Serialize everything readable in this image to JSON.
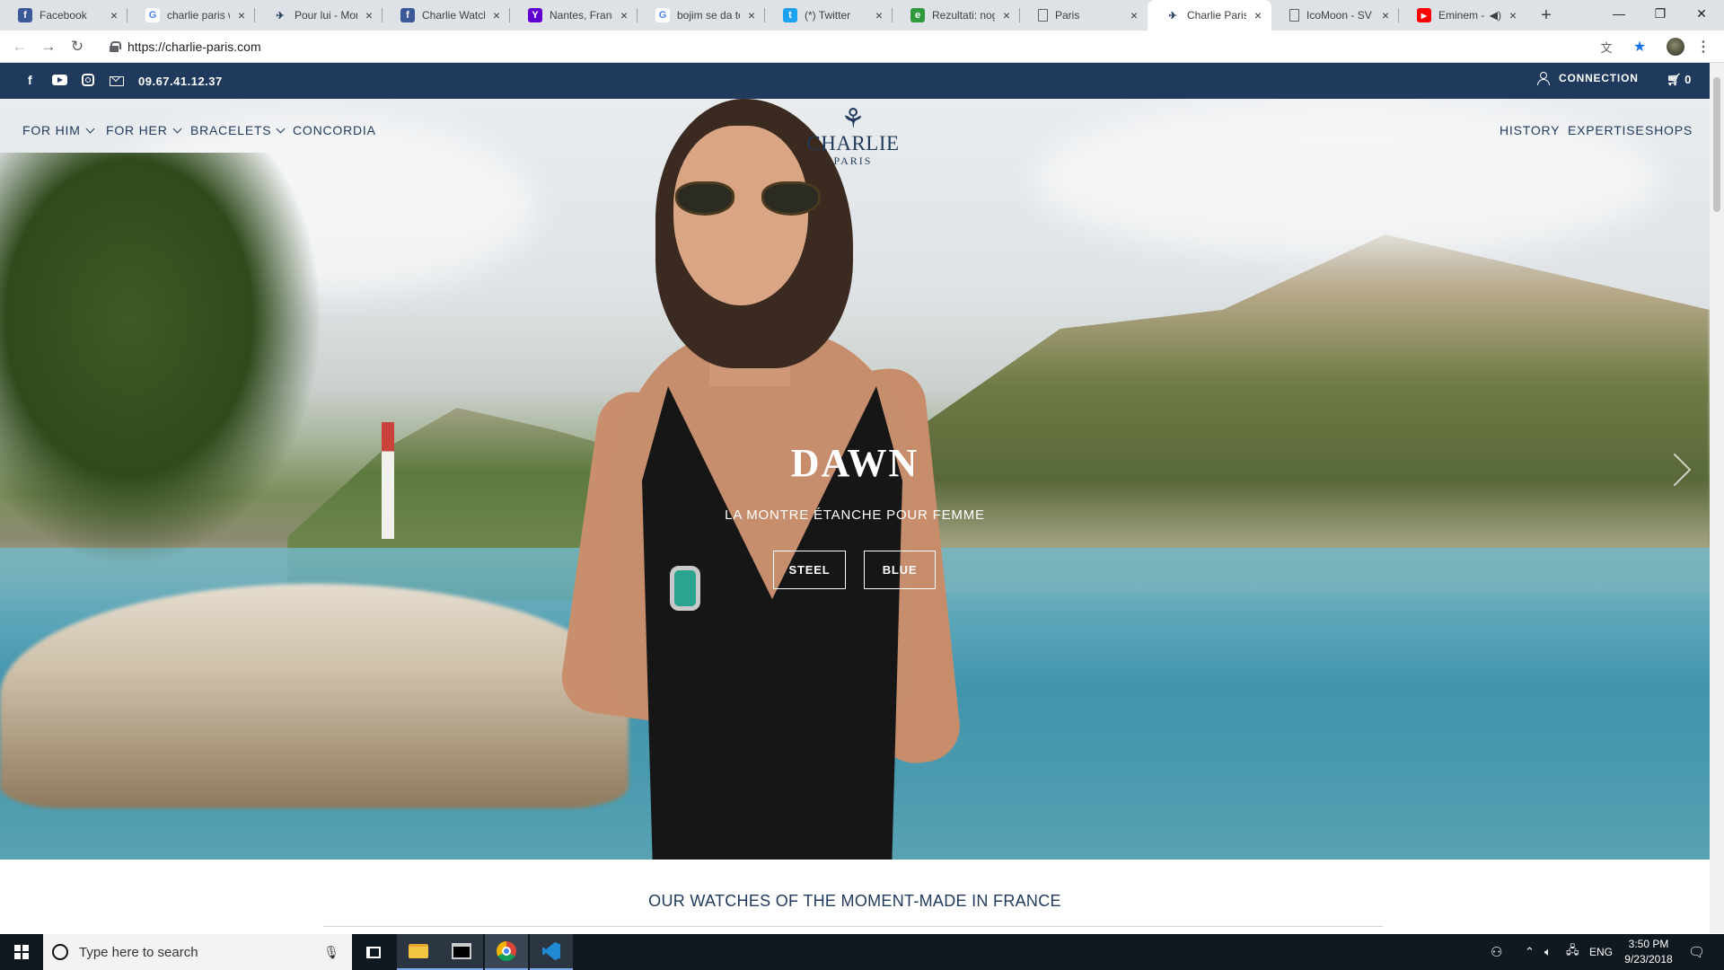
{
  "browser": {
    "tabs": [
      {
        "title": "Facebook",
        "favicon": "facebook-icon",
        "color": "#3b5998",
        "glyph": "f"
      },
      {
        "title": "charlie paris w",
        "favicon": "google-icon",
        "color": "#ffffff",
        "glyph": "G"
      },
      {
        "title": "Pour lui - Mon",
        "favicon": "charlie-bird-icon",
        "color": "#1f3a5c",
        "glyph": "✈"
      },
      {
        "title": "Charlie Watch",
        "favicon": "facebook-icon",
        "color": "#3b5998",
        "glyph": "f"
      },
      {
        "title": "Nantes, France",
        "favicon": "yahoo-icon",
        "color": "#5f01d1",
        "glyph": "Y"
      },
      {
        "title": "bojim se da te",
        "favicon": "google-icon",
        "color": "#ffffff",
        "glyph": "G"
      },
      {
        "title": "(*) Twitter",
        "favicon": "twitter-icon",
        "color": "#1da1f2",
        "glyph": "t"
      },
      {
        "title": "Rezultati: nog",
        "favicon": "green-app-icon",
        "color": "#2e9a3c",
        "glyph": "e"
      },
      {
        "title": "Paris",
        "favicon": "document-icon",
        "color": "#ffffff",
        "glyph": "▯"
      },
      {
        "title": "Charlie Paris-F",
        "favicon": "charlie-bird-icon",
        "color": "#1f3a5c",
        "glyph": "✈",
        "active": true
      },
      {
        "title": "IcoMoon - SV",
        "favicon": "document-icon",
        "color": "#ffffff",
        "glyph": "▯"
      },
      {
        "title": "Eminem -",
        "favicon": "youtube-icon",
        "color": "#ff0000",
        "glyph": "▶"
      }
    ],
    "url": "https://charlie-paris.com"
  },
  "site": {
    "phone": "09.67.41.12.37",
    "connection_label": "CONNECTION",
    "cart_count": "0",
    "logo_name": "CHARLIE",
    "logo_sub": "PARIS",
    "menu_left": [
      "FOR HIM",
      "FOR HER",
      "BRACELETS",
      "CONCORDIA"
    ],
    "menu_right": [
      "HISTORY",
      "EXPERTISE",
      "SHOPS"
    ],
    "slide": {
      "title": "DAWN",
      "subtitle": "LA MONTRE ÉTANCHE POUR FEMME",
      "buttons": [
        "STEEL",
        "BLUE"
      ]
    },
    "section_title": "OUR WATCHES OF THE MOMENT-MADE IN FRANCE",
    "colors": {
      "brand_navy": "#1f3a5c"
    }
  },
  "taskbar": {
    "search_placeholder": "Type here to search",
    "language": "ENG",
    "time": "3:50 PM",
    "date": "9/23/2018"
  }
}
